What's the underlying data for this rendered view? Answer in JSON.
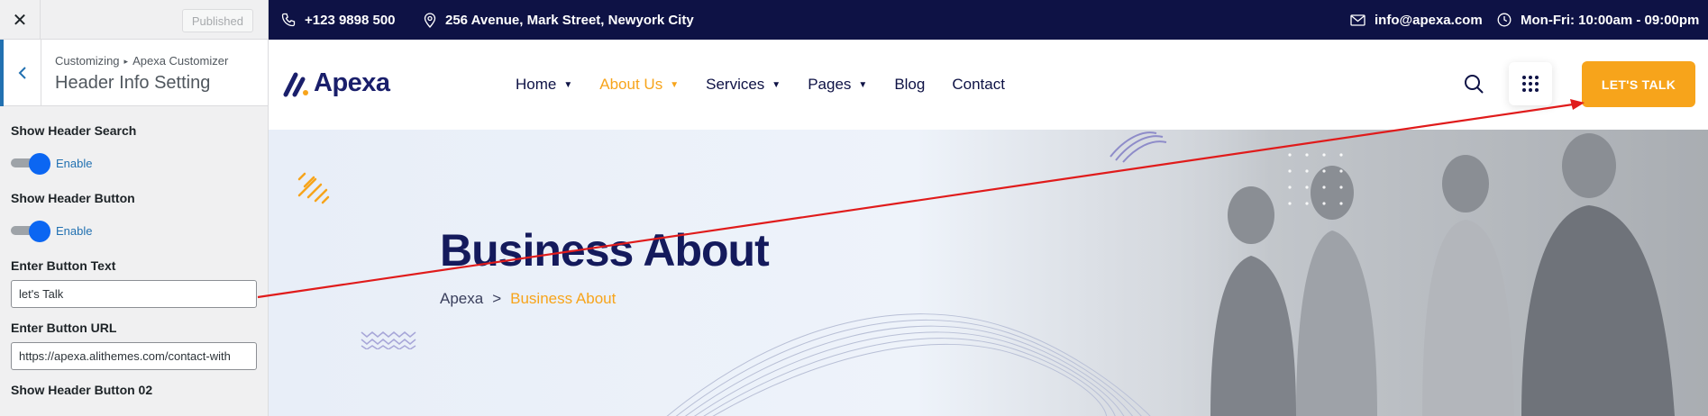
{
  "customizer": {
    "close_icon": "close-icon",
    "published_label": "Published",
    "breadcrumb_root": "Customizing",
    "breadcrumb_parent": "Apexa Customizer",
    "section_title": "Header Info Setting",
    "controls": {
      "show_search_label": "Show Header Search",
      "show_search_toggle": "Enable",
      "show_button_label": "Show Header Button",
      "show_button_toggle": "Enable",
      "button_text_label": "Enter Button Text",
      "button_text_value": "let's Talk",
      "button_url_label": "Enter Button URL",
      "button_url_value": "https://apexa.alithemes.com/contact-with",
      "show_button2_label": "Show Header Button 02"
    }
  },
  "topbar": {
    "phone": "+123 9898 500",
    "address": "256 Avenue, Mark Street, Newyork City",
    "email": "info@apexa.com",
    "hours": "Mon-Fri: 10:00am - 09:00pm"
  },
  "header": {
    "logo_text": "Apexa",
    "nav": [
      {
        "label": "Home",
        "chevron": true
      },
      {
        "label": "About Us",
        "chevron": true,
        "active": true
      },
      {
        "label": "Services",
        "chevron": true
      },
      {
        "label": "Pages",
        "chevron": true
      },
      {
        "label": "Blog",
        "chevron": false
      },
      {
        "label": "Contact",
        "chevron": false
      }
    ],
    "cta_label": "LET'S TALK"
  },
  "hero": {
    "title": "Business About",
    "crumb_home": "Apexa",
    "crumb_sep": ">",
    "crumb_current": "Business About"
  },
  "colors": {
    "accent": "#f7a41b",
    "navy": "#0e1245",
    "wp_blue": "#2271b1",
    "toggle_blue": "#0b66f2",
    "annotation_arrow": "#e01b1b"
  }
}
